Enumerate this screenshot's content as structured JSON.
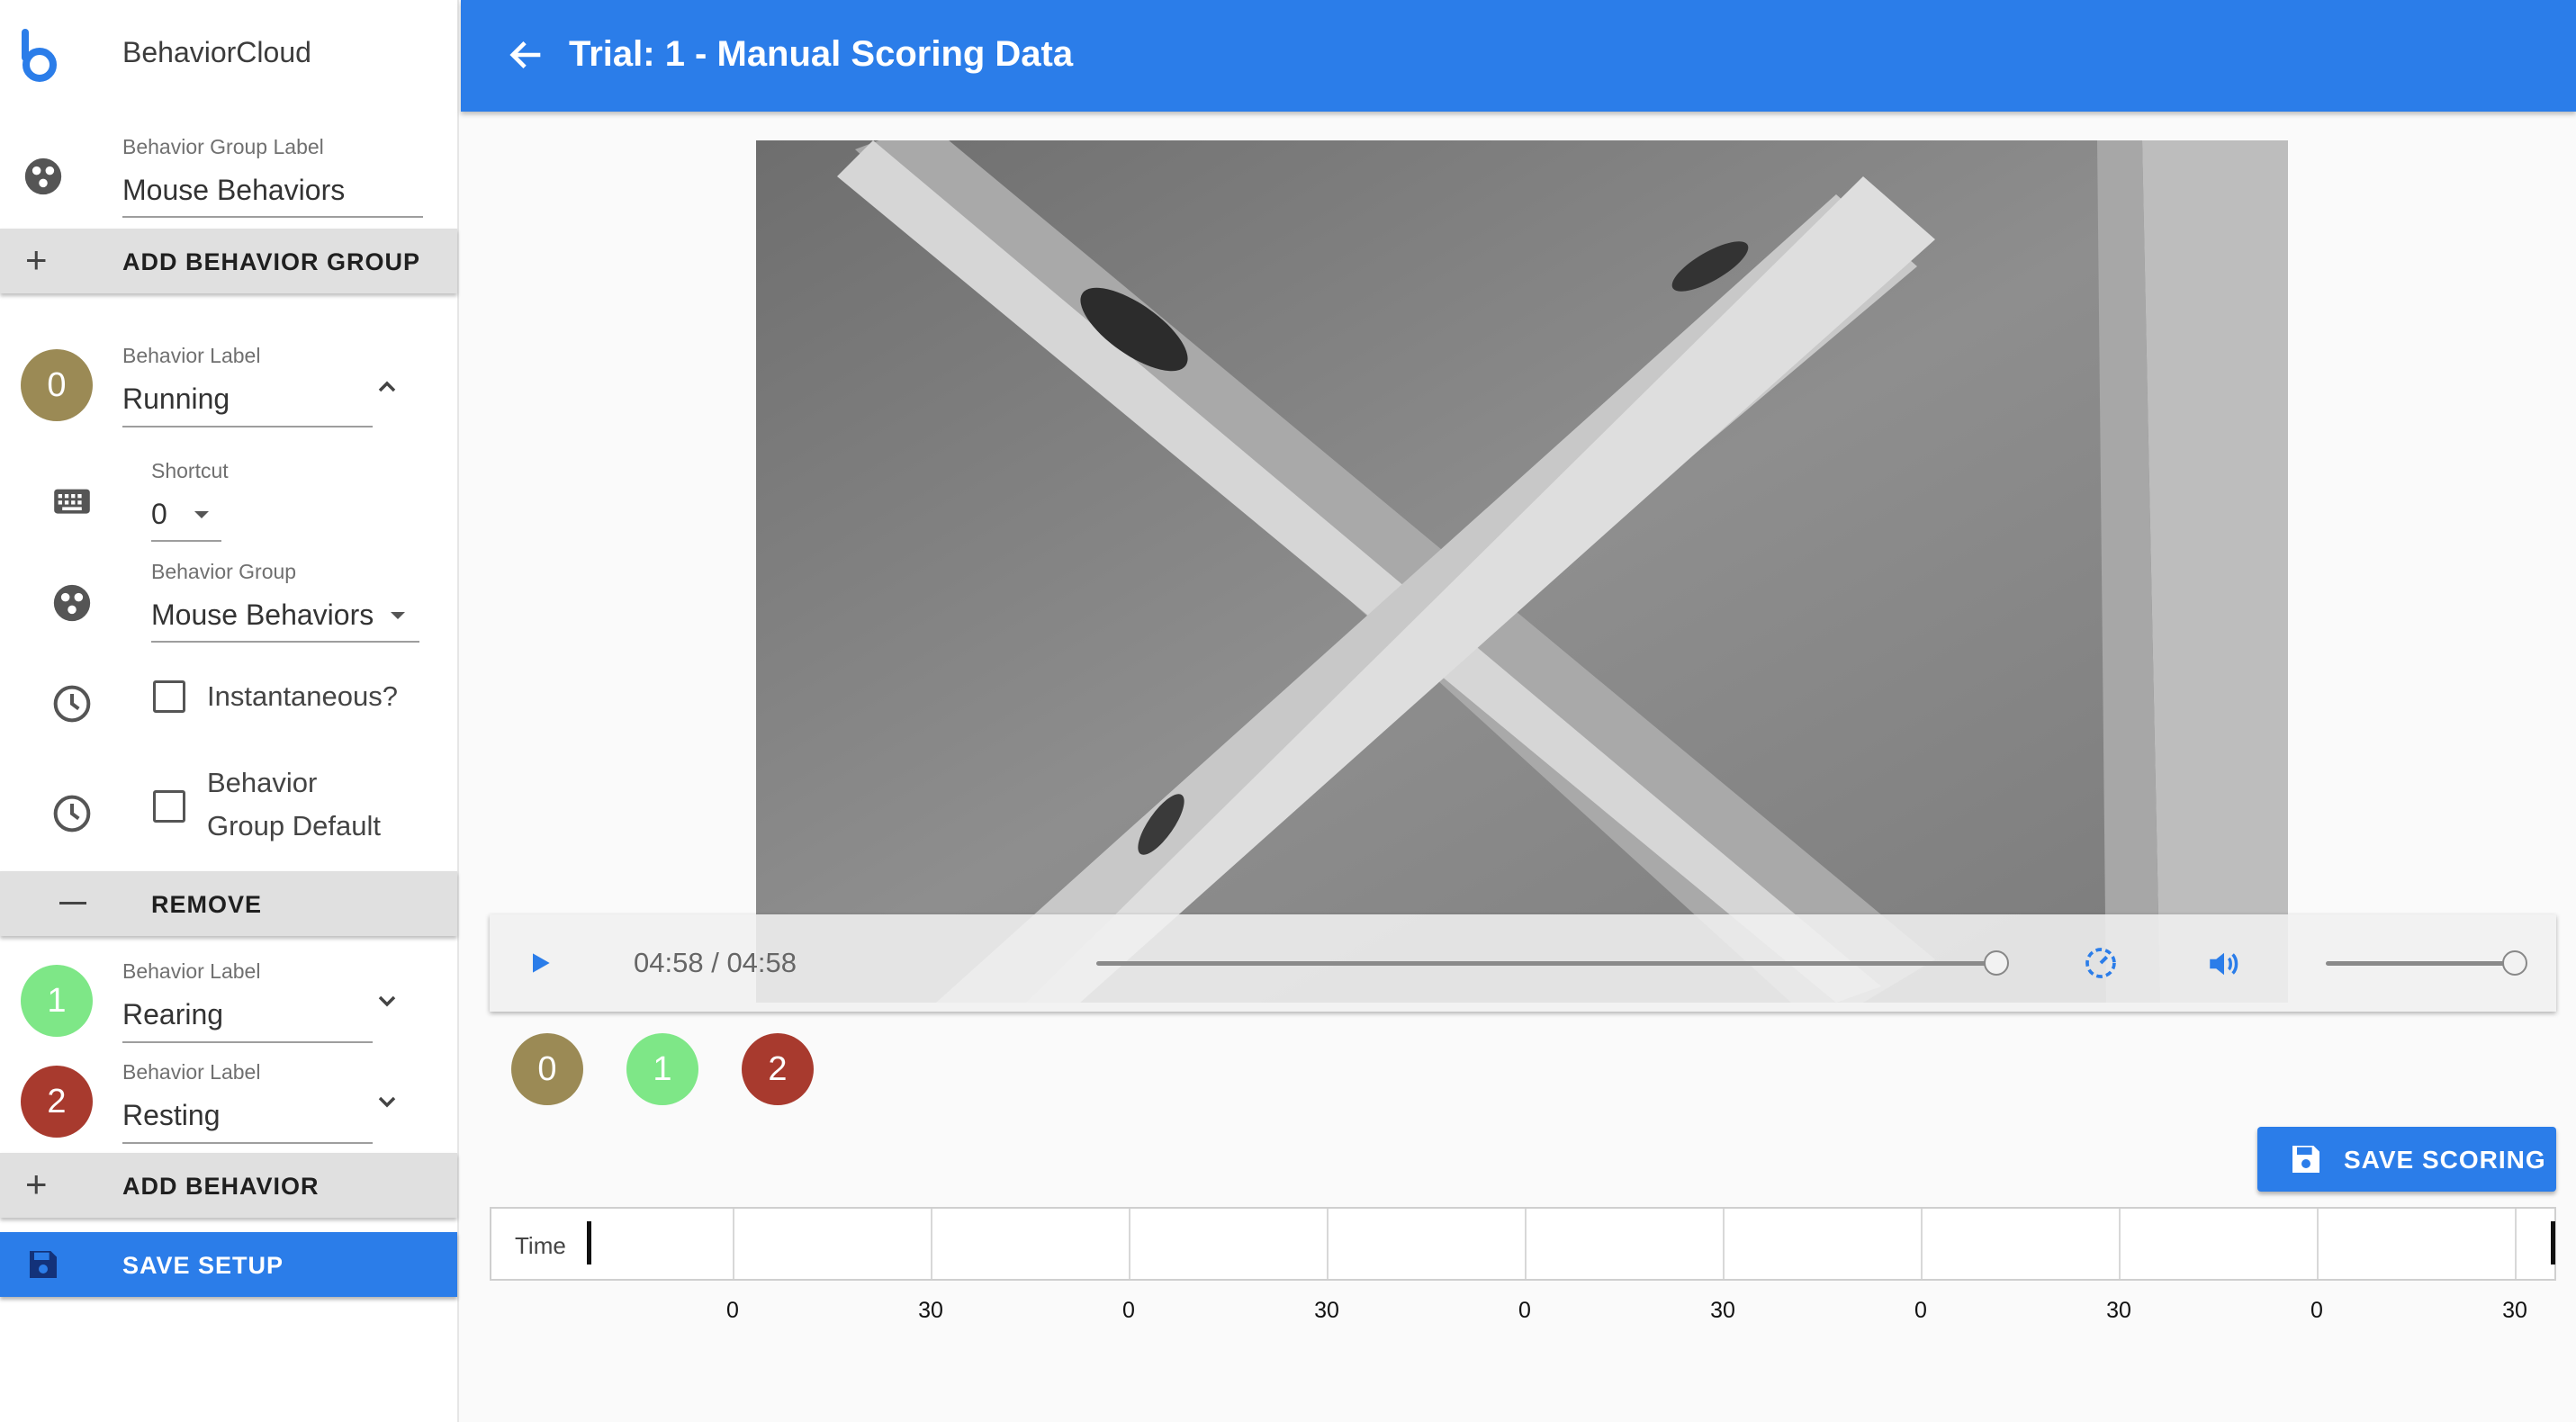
{
  "app": {
    "name": "BehaviorCloud"
  },
  "header": {
    "title": "Trial: 1 - Manual Scoring Data"
  },
  "sidebar": {
    "behavior_group": {
      "label": "Behavior Group Label",
      "value": "Mouse Behaviors"
    },
    "add_behavior_group": "ADD BEHAVIOR GROUP",
    "behaviors": [
      {
        "number": "0",
        "color": "#9b8a55",
        "label": "Behavior Label",
        "value": "Running",
        "expanded": true,
        "shortcut": {
          "label": "Shortcut",
          "value": "0"
        },
        "group": {
          "label": "Behavior Group",
          "value": "Mouse Behaviors"
        },
        "instantaneous": {
          "label": "Instantaneous?",
          "checked": false
        },
        "group_default": {
          "line1": "Behavior",
          "line2": "Group Default",
          "checked": false
        },
        "remove": "REMOVE"
      },
      {
        "number": "1",
        "color": "#7ee787",
        "label": "Behavior Label",
        "value": "Rearing",
        "expanded": false
      },
      {
        "number": "2",
        "color": "#a83a2e",
        "label": "Behavior Label",
        "value": "Resting",
        "expanded": false
      }
    ],
    "add_behavior": "ADD BEHAVIOR",
    "save_setup": "SAVE SETUP"
  },
  "player": {
    "current_time": "04:58",
    "duration": "04:58",
    "progress": 1.0,
    "volume": 1.0
  },
  "score_buttons": [
    {
      "number": "0",
      "color": "#9b8a55"
    },
    {
      "number": "1",
      "color": "#7ee787"
    },
    {
      "number": "2",
      "color": "#a83a2e"
    }
  ],
  "save_scoring": "SAVE SCORING",
  "timeline": {
    "label": "Time",
    "ticks": [
      "0",
      "30",
      "0",
      "30",
      "0",
      "30",
      "0",
      "30",
      "0",
      "30"
    ]
  },
  "colors": {
    "primary": "#2b7de9"
  }
}
